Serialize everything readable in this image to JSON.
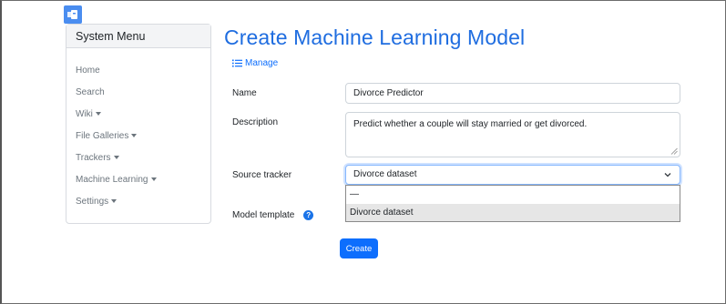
{
  "sidebar": {
    "title": "System Menu",
    "items": [
      {
        "label": "Home",
        "has_caret": false
      },
      {
        "label": "Search",
        "has_caret": false
      },
      {
        "label": "Wiki",
        "has_caret": true
      },
      {
        "label": "File Galleries",
        "has_caret": true
      },
      {
        "label": "Trackers",
        "has_caret": true
      },
      {
        "label": "Machine Learning",
        "has_caret": true
      },
      {
        "label": "Settings",
        "has_caret": true
      }
    ]
  },
  "main": {
    "title": "Create Machine Learning Model",
    "manage_label": "Manage",
    "form": {
      "name_label": "Name",
      "name_value": "Divorce Predictor",
      "description_label": "Description",
      "description_value": "Predict whether a couple will stay married or get divorced.",
      "source_tracker_label": "Source tracker",
      "source_tracker_value": "Divorce dataset",
      "source_tracker_options": [
        "—",
        "Divorce dataset"
      ],
      "model_template_label": "Model template",
      "help_symbol": "?",
      "submit_label": "Create"
    }
  },
  "colors": {
    "accent": "#0d6efd",
    "title": "#1f6de0",
    "muted_text": "#6c757d"
  },
  "icons": [
    "app-icon",
    "list-icon",
    "caret-down-icon",
    "chevron-down-icon",
    "help-icon",
    "resize-grip-icon"
  ]
}
